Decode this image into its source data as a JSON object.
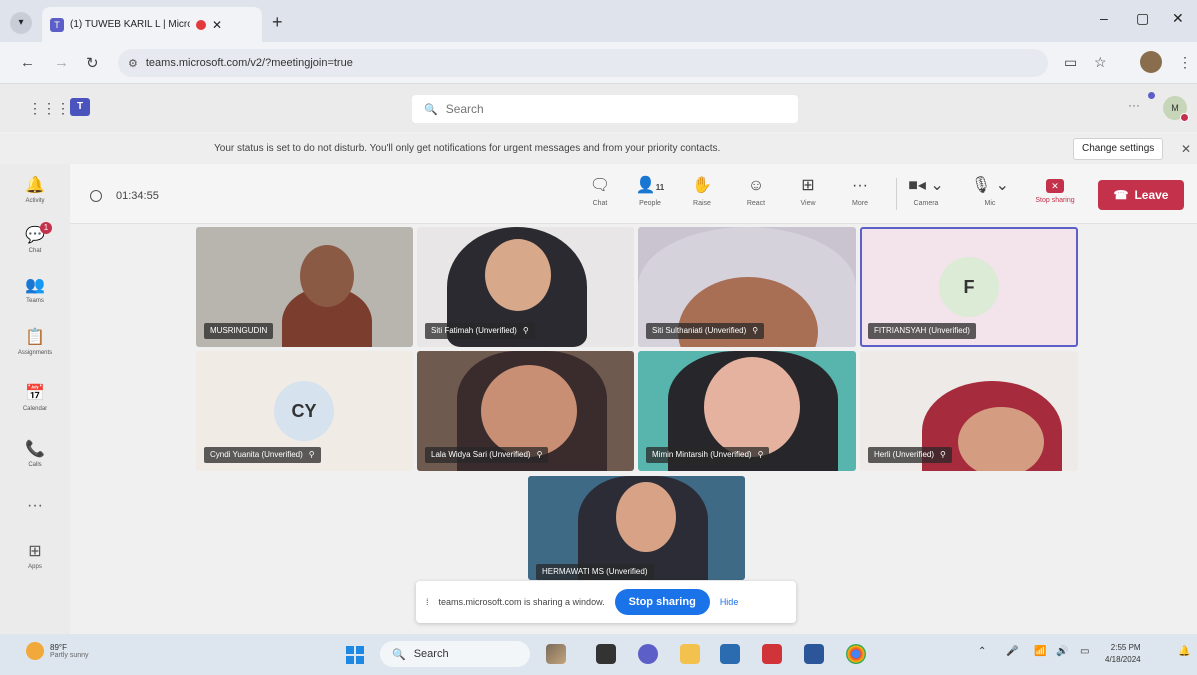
{
  "browser": {
    "tab_title": "(1) TUWEB KARIL L | Micro",
    "url": "teams.microsoft.com/v2/?meetingjoin=true",
    "new_tab": "+",
    "minimize": "–",
    "maximize": "▢",
    "close": "✕"
  },
  "teams": {
    "search_placeholder": "Search",
    "avatar_initials": "M",
    "more": "···"
  },
  "banner": {
    "message": "Your status is set to do not disturb. You'll only get notifications for urgent messages and from your priority contacts.",
    "change_settings": "Change settings"
  },
  "rail": [
    {
      "label": "Activity",
      "icon": "bell-icon",
      "glyph": "🔔"
    },
    {
      "label": "Chat",
      "icon": "chat-icon",
      "glyph": "💬",
      "badge": "1"
    },
    {
      "label": "Teams",
      "icon": "teams-icon",
      "glyph": "👥"
    },
    {
      "label": "Assignments",
      "icon": "assignments-icon",
      "glyph": "📋"
    },
    {
      "label": "Calendar",
      "icon": "calendar-icon",
      "glyph": "📅"
    },
    {
      "label": "Calls",
      "icon": "phone-icon",
      "glyph": "📞"
    },
    {
      "label": "",
      "icon": "more-icon",
      "glyph": "···"
    },
    {
      "label": "Apps",
      "icon": "apps-icon",
      "glyph": "⊞"
    }
  ],
  "meeting": {
    "timer": "01:34:55",
    "toolbar": {
      "chat": "Chat",
      "people": "People",
      "people_count": "11",
      "raise": "Raise",
      "react": "React",
      "view": "View",
      "more": "More",
      "camera": "Camera",
      "mic": "Mic",
      "stop_sharing": "Stop sharing",
      "leave": "Leave"
    }
  },
  "participants": [
    {
      "name": "MUSRINGUDIN",
      "type": "video"
    },
    {
      "name": "Siti Fatimah (Unverified)",
      "type": "video"
    },
    {
      "name": "Siti Sulthaniati (Unverified)",
      "type": "video"
    },
    {
      "name": "FITRIANSYAH (Unverified)",
      "type": "avatar",
      "initials": "F"
    },
    {
      "name": "Cyndi Yuanita (Unverified)",
      "type": "avatar",
      "initials": "CY"
    },
    {
      "name": "Lala Widya Sari (Unverified)",
      "type": "video"
    },
    {
      "name": "Mimin Mintarsih (Unverified)",
      "type": "video"
    },
    {
      "name": "Herli (Unverified)",
      "type": "video"
    },
    {
      "name": "HERMAWATI MS (Unverified)",
      "type": "video"
    }
  ],
  "sharebar": {
    "message": "teams.microsoft.com is sharing a window.",
    "stop": "Stop sharing",
    "hide": "Hide"
  },
  "taskbar": {
    "weather_temp": "89°F",
    "weather_desc": "Partly sunny",
    "search": "Search",
    "time": "2:55 PM",
    "date": "4/18/2024"
  }
}
